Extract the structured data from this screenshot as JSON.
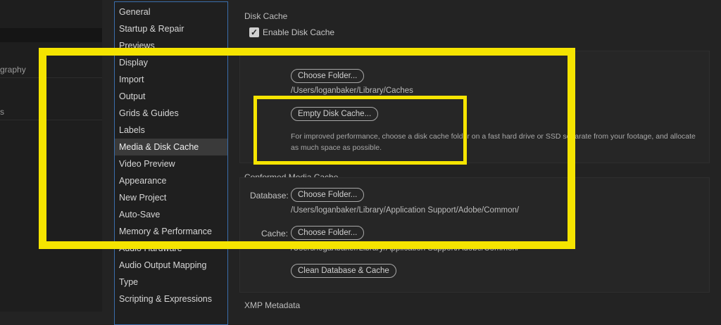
{
  "left_pane": {
    "items": [
      "graphy",
      "s"
    ]
  },
  "nav": {
    "items": [
      "General",
      "Startup & Repair",
      "Previews",
      "Display",
      "Import",
      "Output",
      "Grids & Guides",
      "Labels",
      "Media & Disk Cache",
      "Video Preview",
      "Appearance",
      "New Project",
      "Auto-Save",
      "Memory & Performance",
      "Audio Hardware",
      "Audio Output Mapping",
      "Type",
      "Scripting & Expressions"
    ],
    "selected": "Media & Disk Cache"
  },
  "disk_cache": {
    "title": "Disk Cache",
    "enable_label": "Enable Disk Cache",
    "enabled": true,
    "choose_folder_label": "Choose Folder...",
    "path": "/Users/loganbaker/Library/Caches",
    "empty_label": "Empty Disk Cache...",
    "note": "For improved performance, choose a disk cache folder on a fast hard drive or SSD separate from your footage, and allocate as much space as possible."
  },
  "conformed": {
    "title": "Conformed Media Cache",
    "database_label": "Database:",
    "cache_label": "Cache:",
    "choose_folder_label": "Choose Folder...",
    "database_path": "/Users/loganbaker/Library/Application Support/Adobe/Common/",
    "cache_path": "/Users/loganbaker/Library/Application Support/Adobe/Common/",
    "clean_label": "Clean Database & Cache"
  },
  "xmp": {
    "title": "XMP Metadata"
  },
  "colors": {
    "highlight": "#f5e400",
    "nav_border": "#3a6dab",
    "selected_bg": "#3a3a3a"
  }
}
